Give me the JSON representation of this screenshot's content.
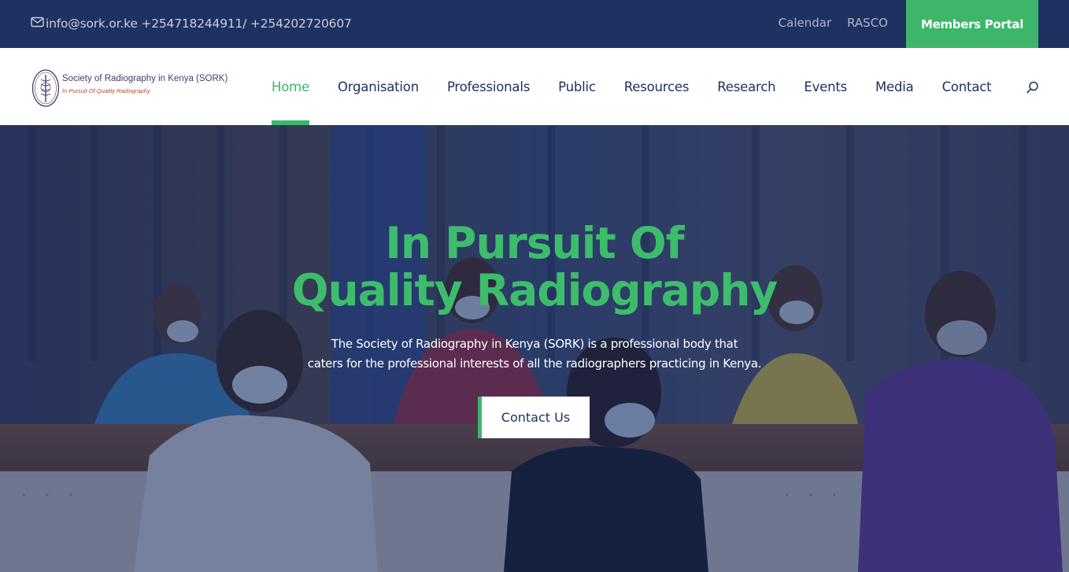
{
  "topbar": {
    "contact_text": "info@sork.or.ke +254718244911/ +254202720607",
    "links": [
      "Calendar",
      "RASCO"
    ],
    "portal_label": "Members Portal"
  },
  "logo": {
    "name": "Society of Radiography in Kenya (SORK)",
    "tagline": "In Pursuit Of Quality Radiography"
  },
  "nav": {
    "items": [
      "Home",
      "Organisation",
      "Professionals",
      "Public",
      "Resources",
      "Research",
      "Events",
      "Media",
      "Contact"
    ],
    "active": "Home"
  },
  "hero": {
    "title_line1": "In Pursuit Of",
    "title_line2": "Quality Radiography",
    "desc_line1": "The Society of Radiography in Kenya (SORK) is a professional body that",
    "desc_line2": "caters for the professional interests of all the radiographers practicing in Kenya.",
    "cta_label": "Contact Us"
  },
  "icons": [
    "mail-icon",
    "search-icon",
    "sork-emblem-logo"
  ],
  "colors": {
    "navy": "#1e3160",
    "green": "#3db66b"
  }
}
